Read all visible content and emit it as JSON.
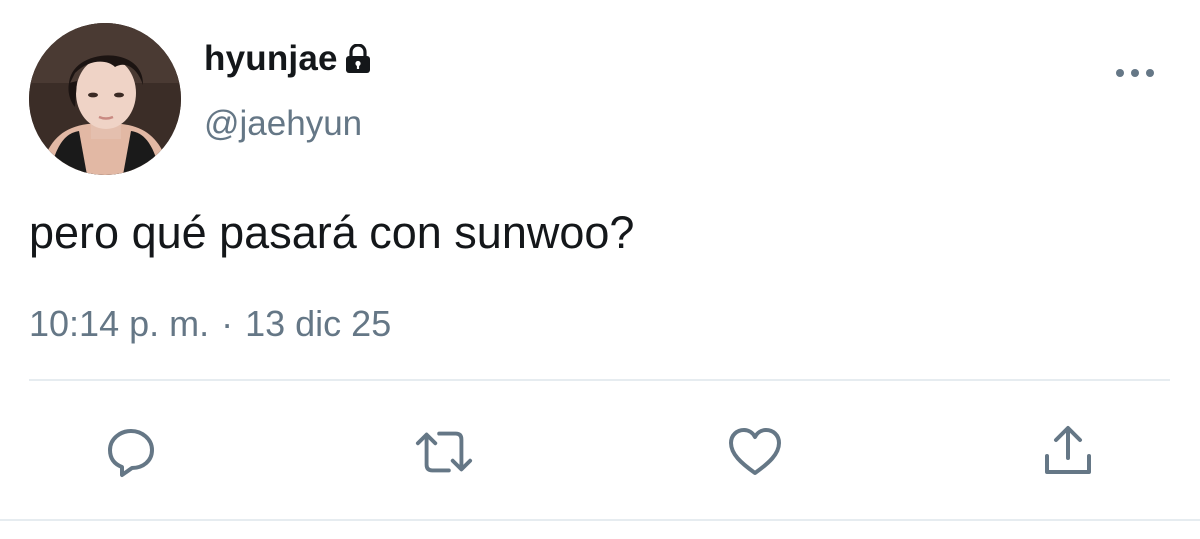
{
  "tweet": {
    "display_name": "hyunjae",
    "handle": "@jaehyun",
    "protected_icon": "lock-icon",
    "text": "pero qué pasará con sunwoo?",
    "time": "10:14 p. m.",
    "separator": "·",
    "date": "13 dic 25"
  },
  "actions": {
    "reply_icon": "reply-icon",
    "retweet_icon": "retweet-icon",
    "like_icon": "heart-icon",
    "share_icon": "share-icon",
    "more_icon": "more-icon"
  },
  "colors": {
    "text": "#14171a",
    "secondary": "#657786",
    "divider": "#e6ecf0",
    "icon": "#657786"
  }
}
